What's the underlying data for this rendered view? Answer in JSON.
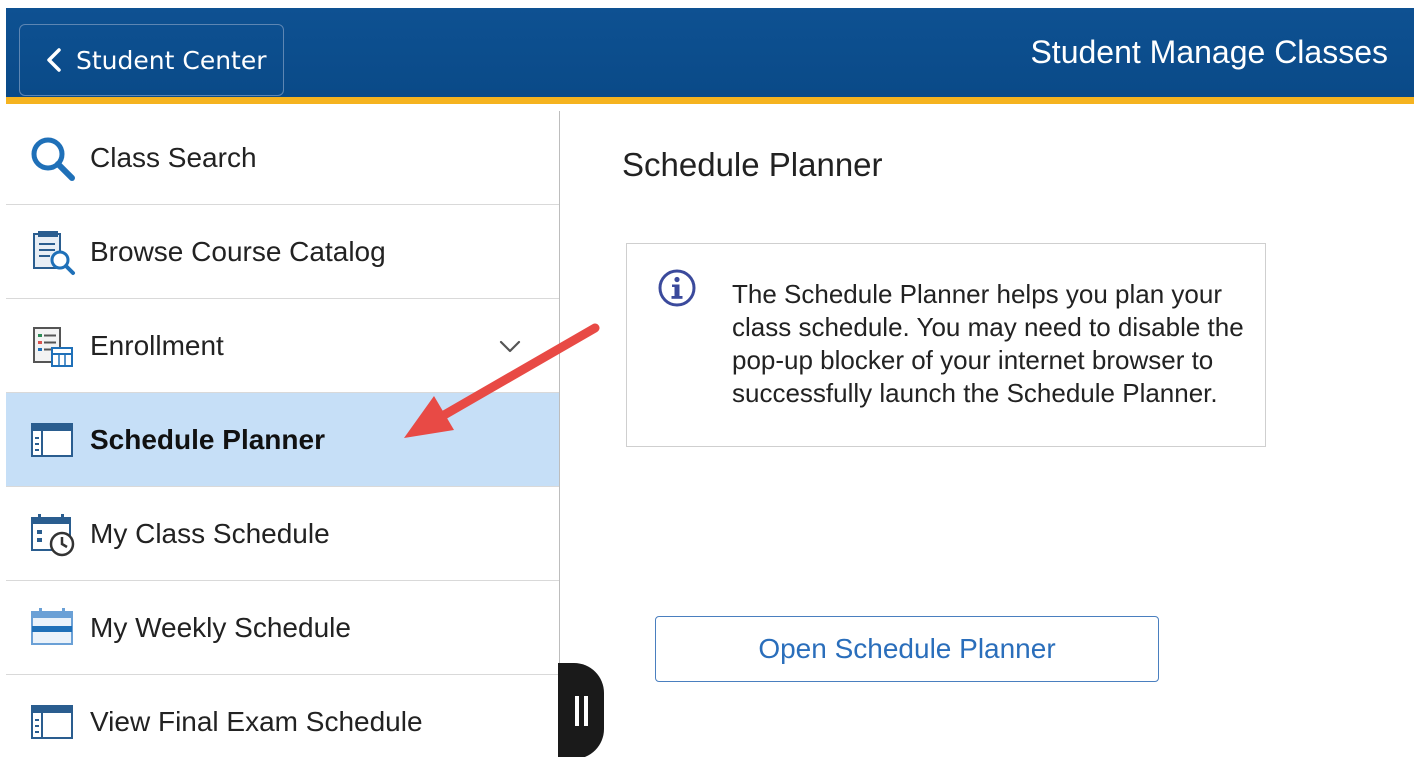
{
  "header": {
    "back_label": "Student Center",
    "title": "Student Manage Classes",
    "accent_color": "#f5b320",
    "bg_color": "#0e5192"
  },
  "sidebar": {
    "items": [
      {
        "label": "Class Search",
        "icon": "search-icon"
      },
      {
        "label": "Browse Course Catalog",
        "icon": "catalog-icon"
      },
      {
        "label": "Enrollment",
        "icon": "enrollment-icon",
        "expandable": true
      },
      {
        "label": "Schedule Planner",
        "icon": "planner-icon",
        "active": true
      },
      {
        "label": "My Class Schedule",
        "icon": "class-schedule-icon"
      },
      {
        "label": "My Weekly Schedule",
        "icon": "weekly-calendar-icon"
      },
      {
        "label": "View Final Exam Schedule",
        "icon": "exam-schedule-icon"
      }
    ],
    "active_color": "#c6dff7"
  },
  "main": {
    "title": "Schedule Planner",
    "info_text": "The Schedule Planner helps you plan your class schedule.  You may need to disable the pop-up blocker of your internet browser to successfully launch the Schedule Planner.",
    "open_button_label": "Open Schedule Planner"
  },
  "annotation": {
    "arrow_color": "#e84a45"
  }
}
